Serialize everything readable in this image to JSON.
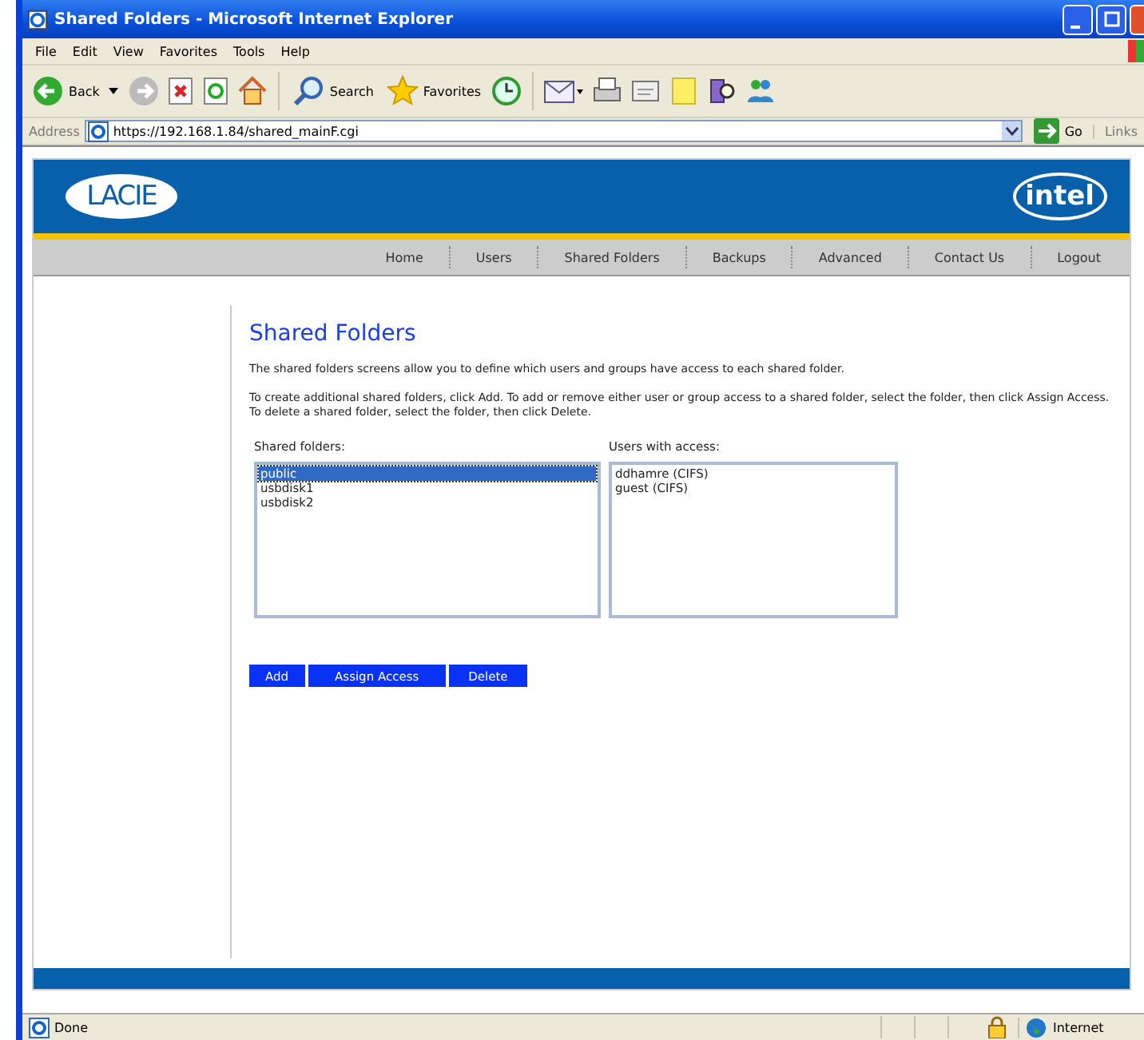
{
  "window": {
    "title": "Shared Folders - Microsoft Internet Explorer"
  },
  "menu": [
    "File",
    "Edit",
    "View",
    "Favorites",
    "Tools",
    "Help"
  ],
  "toolbar": {
    "back": "Back",
    "search": "Search",
    "favorites": "Favorites"
  },
  "address": {
    "label": "Address",
    "value": "https://192.168.1.84/shared_mainF.cgi",
    "go": "Go",
    "links": "Links"
  },
  "header": {
    "left_logo": "LACIE",
    "right_logo": "intel"
  },
  "nav": [
    "Home",
    "Users",
    "Shared Folders",
    "Backups",
    "Advanced",
    "Contact Us",
    "Logout"
  ],
  "page": {
    "title": "Shared Folders",
    "intro": "The shared folders screens allow you to define which users and groups have access to each shared folder.",
    "help": "To create additional shared folders, click Add. To add or remove either user or group access to a shared folder, select the folder, then click Assign Access. To delete a shared folder, select the folder, then click Delete."
  },
  "folders": {
    "label": "Shared folders:",
    "items": [
      {
        "name": "public",
        "selected": true
      },
      {
        "name": "usbdisk1",
        "selected": false
      },
      {
        "name": "usbdisk2",
        "selected": false
      }
    ]
  },
  "users": {
    "label": "Users with access:",
    "items": [
      {
        "name": "ddhamre (CIFS)",
        "selected": false
      },
      {
        "name": "guest (CIFS)",
        "selected": false
      }
    ]
  },
  "buttons": [
    "Add",
    "Assign Access",
    "Delete"
  ],
  "status_bar": {
    "text": "Done",
    "zone": "Internet"
  }
}
